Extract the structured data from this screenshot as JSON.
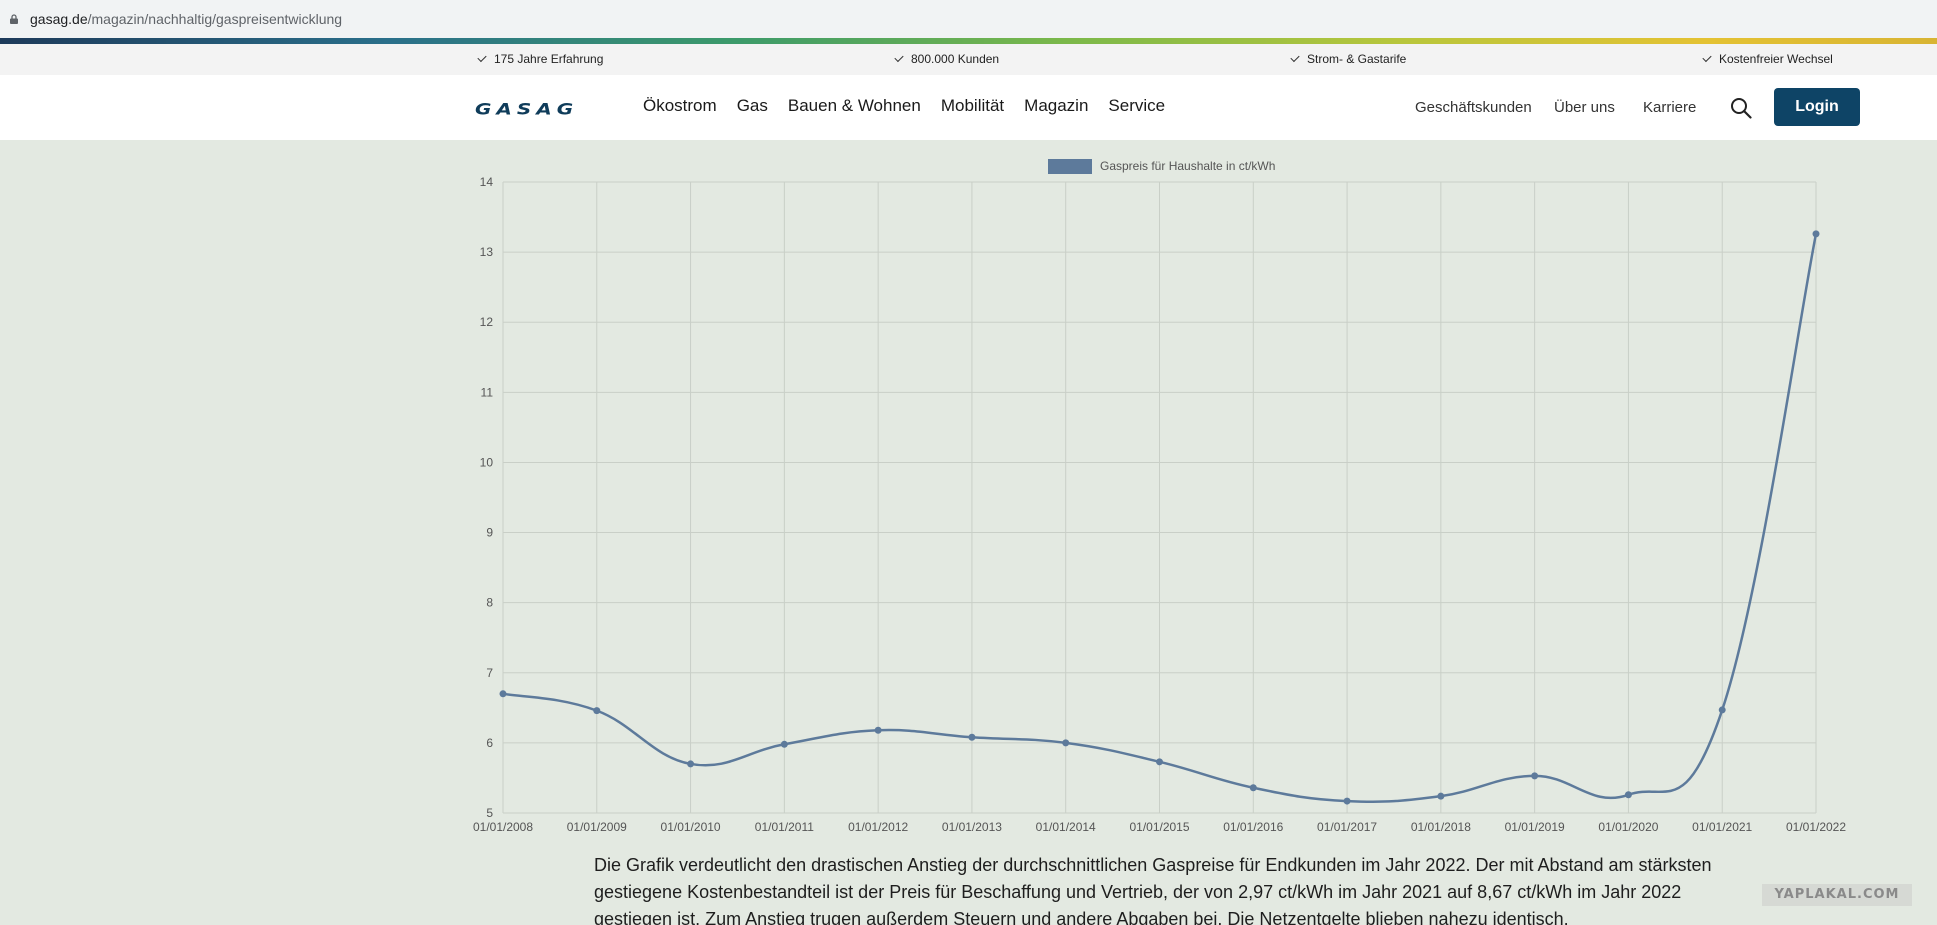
{
  "browser": {
    "url_host": "gasag.de",
    "url_path": "/magazin/nachhaltig/gaspreisentwicklung"
  },
  "usp": [
    {
      "label": "175 Jahre Erfahrung"
    },
    {
      "label": "800.000 Kunden"
    },
    {
      "label": "Strom- & Gastarife"
    },
    {
      "label": "Kostenfreier Wechsel"
    }
  ],
  "nav": {
    "logo": "GASAG",
    "main": [
      "Ökostrom",
      "Gas",
      "Bauen & Wohnen",
      "Mobilität",
      "Magazin",
      "Service"
    ],
    "secondary": [
      "Geschäftskunden",
      "Über uns",
      "Karriere"
    ],
    "login": "Login"
  },
  "colors": {
    "series": "#5d7a9b",
    "brand": "#0e4466",
    "grid": "#c9cfc7"
  },
  "chart_data": {
    "type": "line",
    "title": "",
    "xlabel": "",
    "ylabel": "",
    "categories": [
      "01/01/2008",
      "01/01/2009",
      "01/01/2010",
      "01/01/2011",
      "01/01/2012",
      "01/01/2013",
      "01/01/2014",
      "01/01/2015",
      "01/01/2016",
      "01/01/2017",
      "01/01/2018",
      "01/01/2019",
      "01/01/2020",
      "01/01/2021",
      "01/01/2022"
    ],
    "series": [
      {
        "name": "Gaspreis für Haushalte in ct/kWh",
        "values": [
          6.7,
          6.46,
          5.7,
          5.98,
          6.18,
          6.08,
          6.0,
          5.73,
          5.36,
          5.17,
          5.24,
          5.53,
          5.26,
          6.47,
          13.26
        ]
      }
    ],
    "ylim": [
      5,
      14
    ],
    "yticks": [
      5,
      6,
      7,
      8,
      9,
      10,
      11,
      12,
      13,
      14
    ],
    "grid": true,
    "legend": "top-center"
  },
  "article": {
    "paragraph": "Die Grafik verdeutlicht den drastischen Anstieg der durchschnittlichen Gaspreise für Endkunden im Jahr 2022. Der mit Abstand am stärksten gestiegene Kostenbestandteil ist der Preis für Beschaffung und Vertrieb, der von 2,97 ct/kWh im Jahr 2021 auf 8,67 ct/kWh im Jahr 2022 gestiegen ist. Zum Anstieg trugen außerdem Steuern und andere Abgaben bei. Die Netzentgelte blieben nahezu identisch."
  },
  "watermark": "YAPLAKAL.COM"
}
